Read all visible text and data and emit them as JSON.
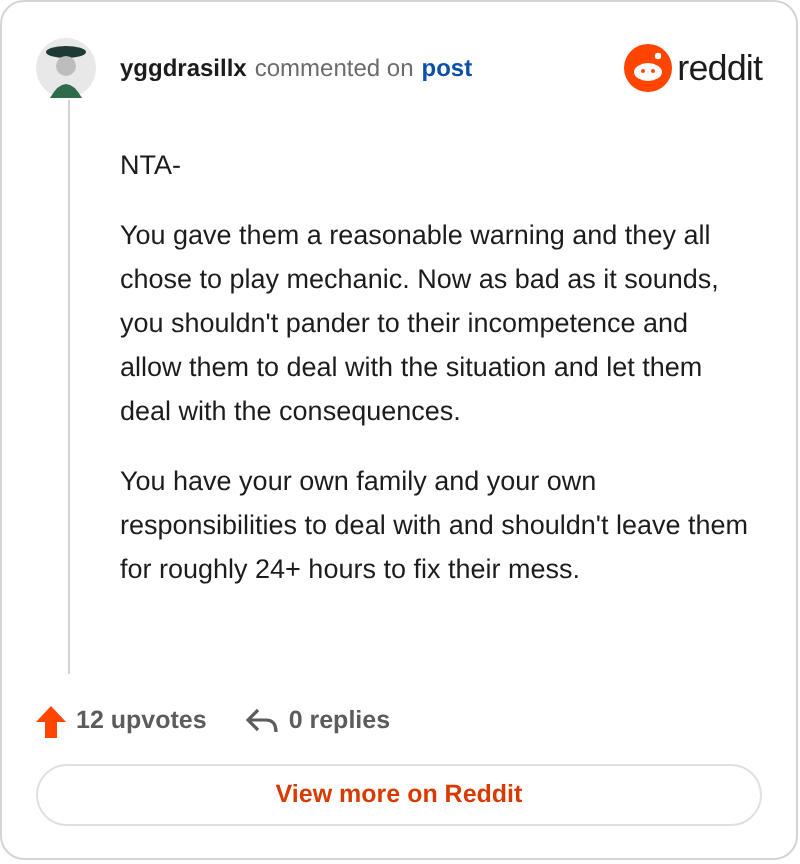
{
  "comment": {
    "author": "yggdrasillx",
    "action": "commented on",
    "target": "post",
    "paragraphs": [
      "NTA-",
      "You gave them a reasonable warning and they all chose to play mechanic. Now as bad as it sounds, you shouldn't pander to their incompetence and allow them to deal with the situation and let them deal with the consequences.",
      "You have your own family and your own responsibilities to deal with and shouldn't leave them for roughly 24+ hours to fix their mess."
    ]
  },
  "brand": {
    "wordmark": "reddit"
  },
  "stats": {
    "upvotes": "12 upvotes",
    "replies": "0 replies"
  },
  "button": {
    "label": "View more on Reddit"
  }
}
